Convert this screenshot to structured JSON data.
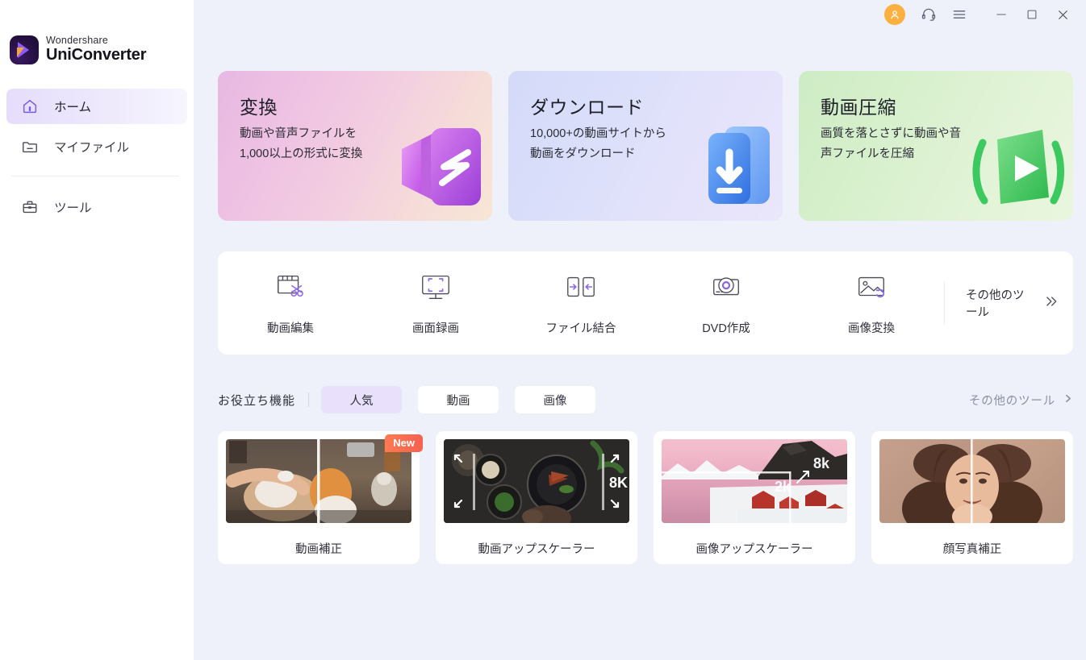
{
  "app": {
    "brand_top": "Wondershare",
    "brand_main": "UniConverter"
  },
  "titlebar": {
    "avatar_icon": "user-avatar-icon",
    "support_icon": "headset-icon",
    "menu_icon": "hamburger-menu-icon",
    "minimize_icon": "minimize-icon",
    "maximize_icon": "maximize-icon",
    "close_icon": "close-icon",
    "avatar_color": "#fbb040"
  },
  "sidebar": {
    "items": [
      {
        "label": "ホーム",
        "icon": "home-icon",
        "active": true
      },
      {
        "label": "マイファイル",
        "icon": "folder-icon",
        "active": false
      },
      {
        "label": "ツール",
        "icon": "toolbox-icon",
        "active": false
      }
    ]
  },
  "hero_cards": [
    {
      "title": "変換",
      "desc": "動画や音声ファイルを1,000以上の形式に変換",
      "icon": "convert-icon",
      "accent": "#c36fd0"
    },
    {
      "title": "ダウンロード",
      "desc": "10,000+の動画サイトから動画をダウンロード",
      "icon": "download-icon",
      "accent": "#4a90f4"
    },
    {
      "title": "動画圧縮",
      "desc": "画質を落とさずに動画や音声ファイルを圧縮",
      "icon": "compress-icon",
      "accent": "#3fc96b"
    }
  ],
  "tools": {
    "items": [
      {
        "label": "動画編集",
        "icon": "video-edit-scissors-icon"
      },
      {
        "label": "画面録画",
        "icon": "screen-record-monitor-icon"
      },
      {
        "label": "ファイル結合",
        "icon": "merge-files-icon"
      },
      {
        "label": "DVD作成",
        "icon": "dvd-disc-icon"
      },
      {
        "label": "画像変換",
        "icon": "image-convert-icon"
      }
    ],
    "more_label": "その他のツール",
    "more_icon": "double-chevron-right-icon"
  },
  "features_section": {
    "title": "お役立ち機能",
    "tabs": [
      {
        "label": "人気",
        "selected": true
      },
      {
        "label": "動画",
        "selected": false
      },
      {
        "label": "画像",
        "selected": false
      }
    ],
    "more_label": "その他のツール",
    "more_icon": "chevron-right-icon",
    "cards": [
      {
        "label": "動画補正",
        "badge": "New",
        "thumb": "dog-before-after-thumb",
        "overlay": ""
      },
      {
        "label": "動画アップスケーラー",
        "badge": "",
        "thumb": "food-table-thumb",
        "overlay": "8K"
      },
      {
        "label": "画像アップスケーラー",
        "badge": "",
        "thumb": "snow-village-thumb",
        "overlay_low": "2k",
        "overlay_high": "8k"
      },
      {
        "label": "顔写真補正",
        "badge": "",
        "thumb": "portrait-before-after-thumb",
        "overlay": ""
      }
    ]
  }
}
